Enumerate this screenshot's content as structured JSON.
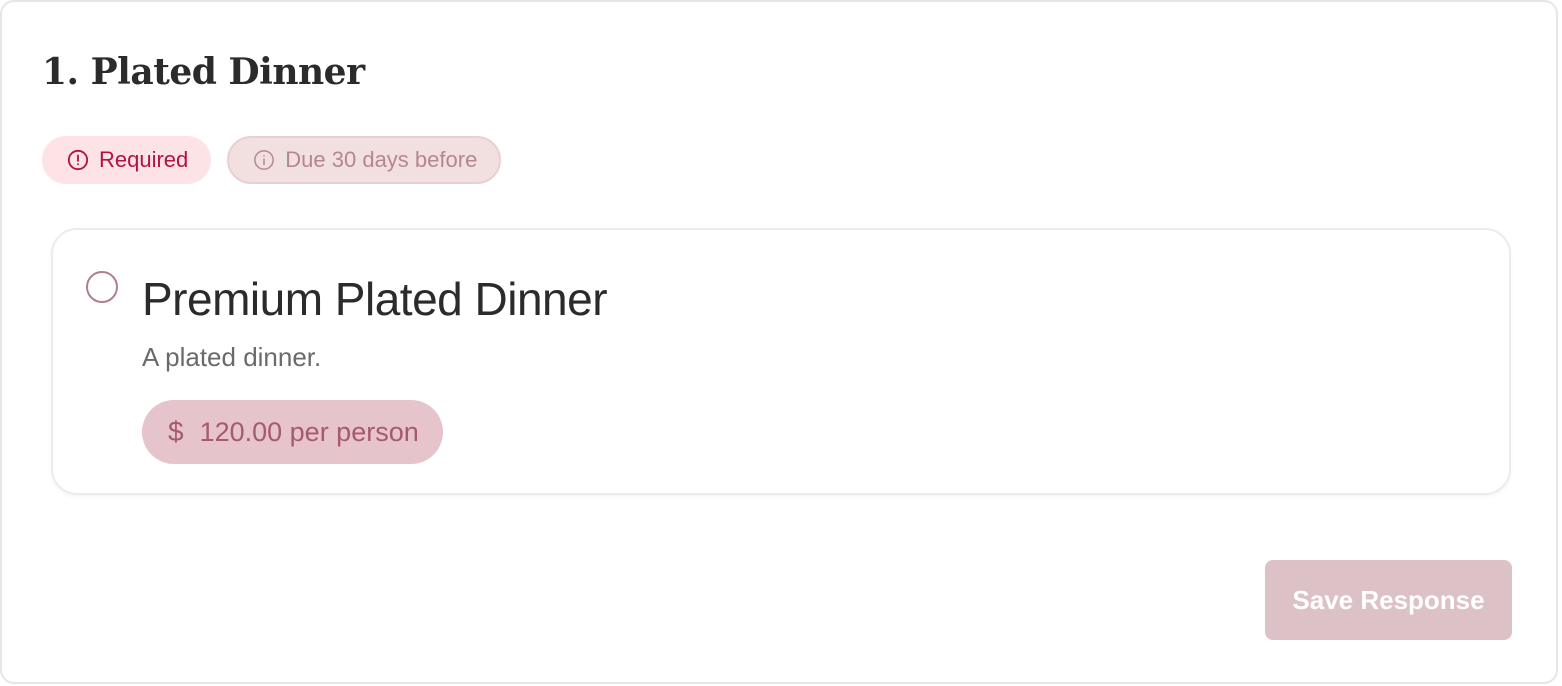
{
  "section": {
    "title": "1. Plated Dinner"
  },
  "badges": {
    "required_label": "Required",
    "due_label": "Due 30 days before",
    "required_icon": "alert-circle-icon",
    "due_icon": "info-circle-icon"
  },
  "option": {
    "name": "Premium Plated Dinner",
    "description": "A plated dinner.",
    "currency_symbol": "$",
    "price_label": "120.00 per person",
    "selected": false,
    "price_icon": "dollar-icon"
  },
  "actions": {
    "save_label": "Save Response"
  },
  "colors": {
    "required_bg": "#fde3e5",
    "required_text": "#b5123d",
    "due_bg": "#f2e0e1",
    "due_text": "#b58690",
    "price_bg": "#e6c4cb",
    "price_text": "#a75a6b",
    "save_button_bg": "#dcc1c7",
    "radio_border": "#b07f8c"
  }
}
